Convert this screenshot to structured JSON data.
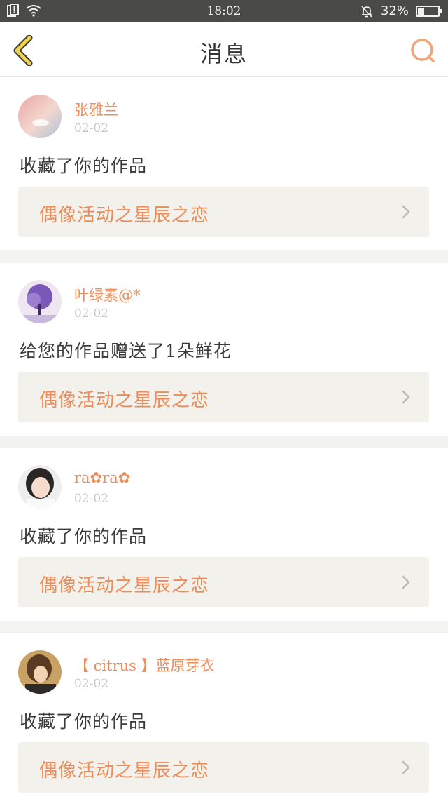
{
  "status": {
    "time": "18:02",
    "battery": "32%",
    "battery_level": 0.32
  },
  "header": {
    "title": "消息"
  },
  "notifications": [
    {
      "user": "张雅兰",
      "date": "02-02",
      "action": "收藏了你的作品",
      "work": "偶像活动之星辰之恋"
    },
    {
      "user": "叶绿素@*",
      "date": "02-02",
      "action": "给您的作品赠送了1朵鲜花",
      "work": "偶像活动之星辰之恋"
    },
    {
      "user": "ra✿ra✿",
      "date": "02-02",
      "action": "收藏了你的作品",
      "work": "偶像活动之星辰之恋"
    },
    {
      "user": "【 citrus 】蓝原芽衣",
      "date": "02-02",
      "action": "收藏了你的作品",
      "work": "偶像活动之星辰之恋"
    }
  ],
  "colors": {
    "accent": "#ec8c58",
    "back_arrow": "#f2d24a",
    "status_bar": "#4a4a48",
    "panel": "#f2f1ec"
  }
}
